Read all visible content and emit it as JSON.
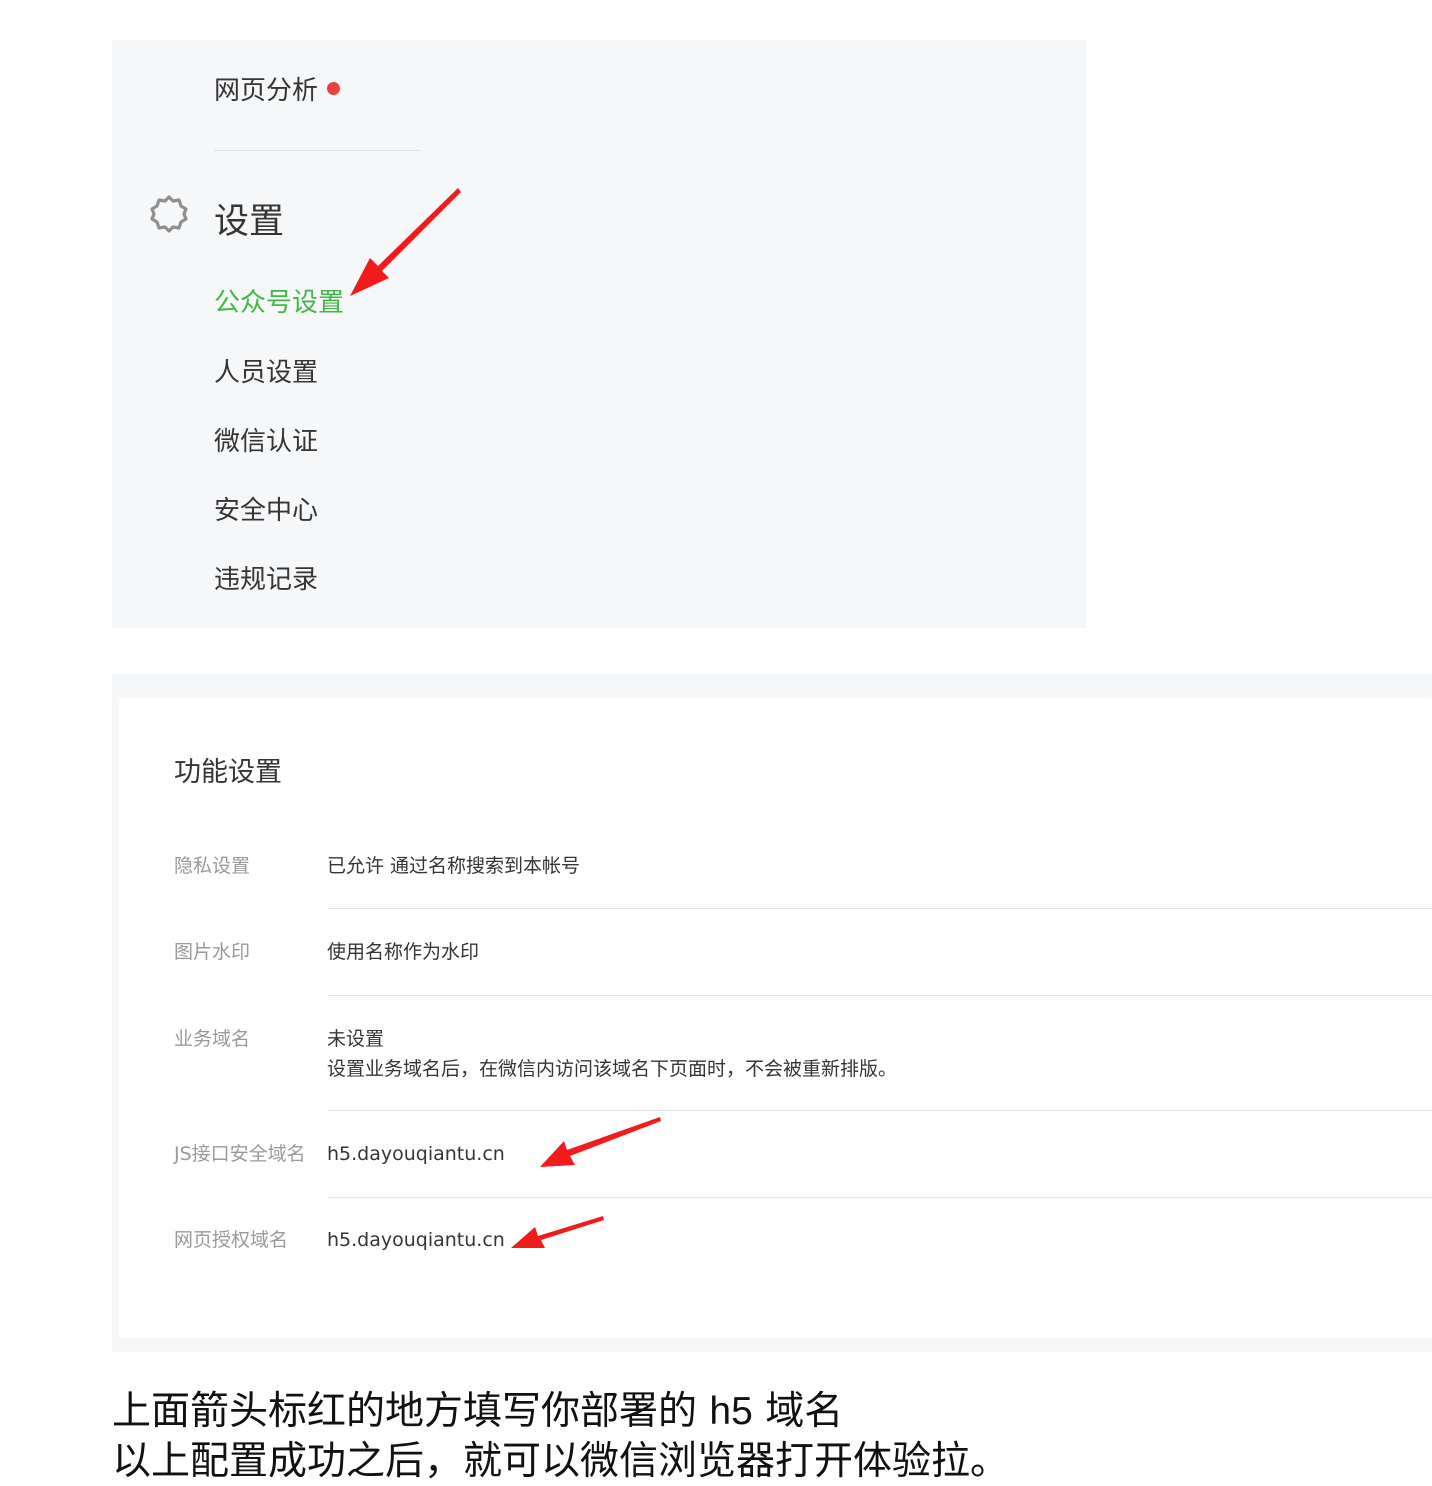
{
  "menu": {
    "web_analysis_label": "网页分析",
    "settings_group_title": "设置",
    "items": [
      {
        "label": "公众号设置",
        "active": true
      },
      {
        "label": "人员设置",
        "active": false
      },
      {
        "label": "微信认证",
        "active": false
      },
      {
        "label": "安全中心",
        "active": false
      },
      {
        "label": "违规记录",
        "active": false
      }
    ]
  },
  "function_settings": {
    "title": "功能设置",
    "rows": [
      {
        "label": "隐私设置",
        "value": "已允许 通过名称搜索到本帐号"
      },
      {
        "label": "图片水印",
        "value": "使用名称作为水印"
      },
      {
        "label": "业务域名",
        "value": "未设置",
        "description": "设置业务域名后，在微信内访问该域名下页面时，不会被重新排版。"
      },
      {
        "label": "JS接口安全域名",
        "value": "h5.dayouqiantu.cn"
      },
      {
        "label": "网页授权域名",
        "value": "h5.dayouqiantu.cn"
      }
    ]
  },
  "instructions": {
    "line1_part1": "上面箭头标红的地方填写你部署的 ",
    "line1_h5": "h5",
    "line1_part2": " 域名",
    "line2": "以上配置成功之后，就可以微信浏览器打开体验拉。"
  },
  "colors": {
    "accent_green": "#44b549",
    "annotation_red": "#f21b1b",
    "badge_red": "#e64340"
  },
  "icons": {
    "settings": "gear-icon",
    "notification": "red-dot-badge",
    "annotation": "red-arrow"
  }
}
